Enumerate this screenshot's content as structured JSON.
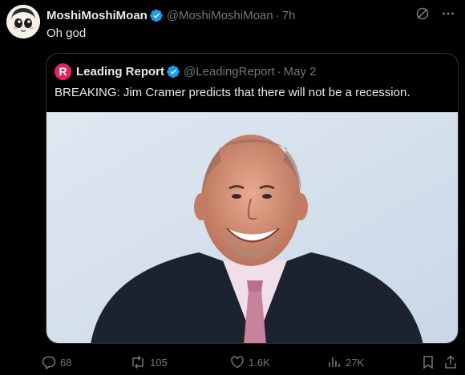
{
  "tweet": {
    "author_name": "MoshiMoshiMoan",
    "author_handle": "@MoshiMoshiMoan",
    "separator": "·",
    "time": "7h",
    "text": "Oh god"
  },
  "quoted": {
    "logo_letter": "R",
    "author_name": "Leading Report",
    "author_handle": "@LeadingReport",
    "separator": "·",
    "date": "May 2",
    "text": "BREAKING: Jim Cramer predicts that there will not be a recession."
  },
  "actions": {
    "replies": "68",
    "reposts": "105",
    "likes": "1.6K",
    "views": "27K"
  },
  "colors": {
    "background": "#000000",
    "text": "#e7e9ea",
    "secondary": "#71767b",
    "verified": "#1d9bf0",
    "border": "#2f3336",
    "leading_report_red": "#e0245e"
  },
  "icons": [
    "verified-badge-icon",
    "grok-icon",
    "more-icon",
    "reply-icon",
    "repost-icon",
    "like-icon",
    "views-icon",
    "bookmark-icon",
    "share-icon"
  ]
}
